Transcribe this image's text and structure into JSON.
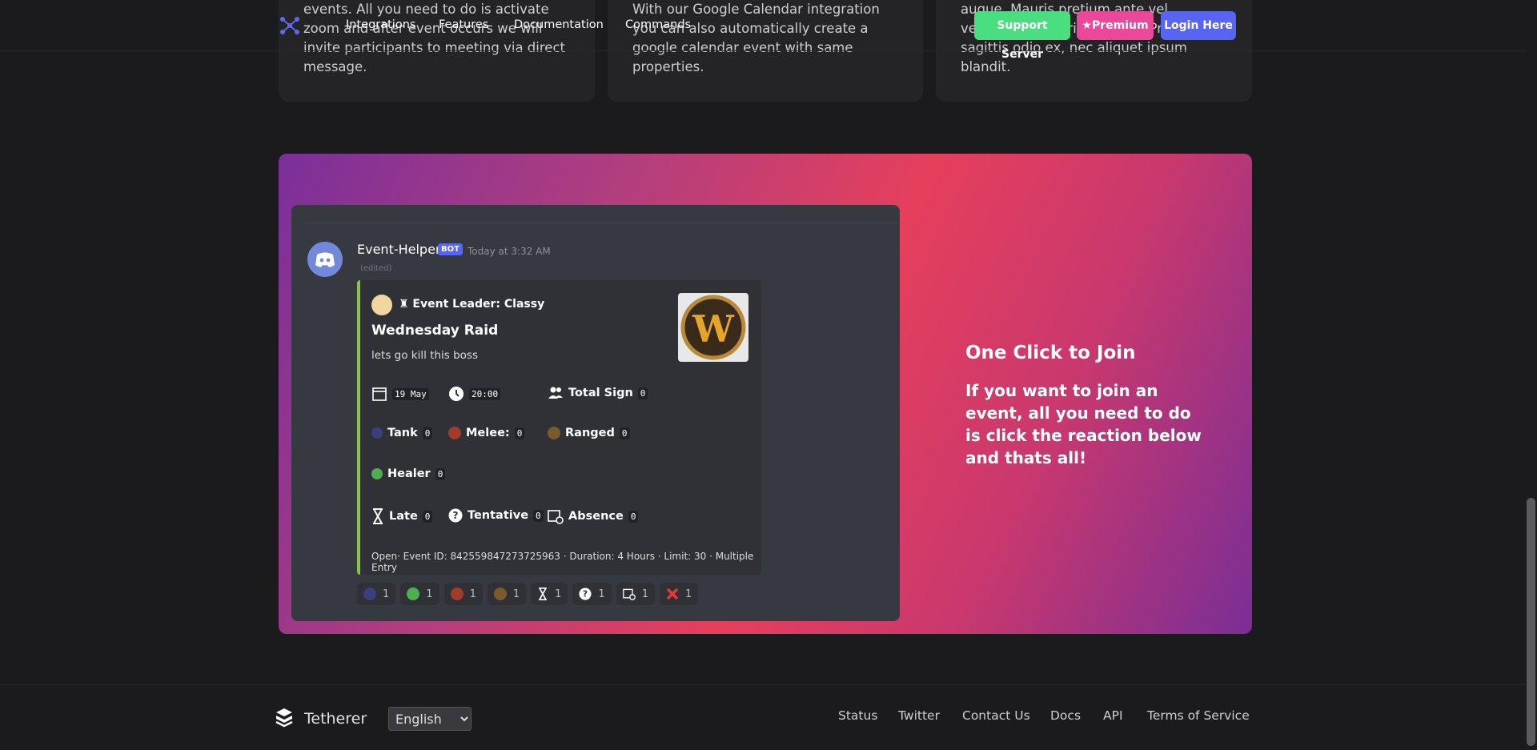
{
  "feature_cards": [
    {
      "text": "events. All you need to do is activate zoom and after event occurs we will invite participants to meeting via direct message."
    },
    {
      "text": "With our Google Calendar integration you can also automatically create a google calendar event with same properties."
    },
    {
      "text": "adipiscing elit. Donec placerat lectus augue. Mauris pretium ante vel vestibulum mauris aliquam. Praesent sagittis odio ex, nec aliquet ipsum blandit."
    }
  ],
  "nav": {
    "links": [
      "Integrations",
      "Features",
      "Documentation",
      "Commands"
    ],
    "support_label": "Support Server",
    "premium_label": "★Premium",
    "login_label": "Login Here",
    "colors": {
      "support": "#4ade80",
      "premium": "#ec4899",
      "login": "#5865f2"
    }
  },
  "message": {
    "username": "Event-Helper",
    "bot_tag": "BOT",
    "timestamp": "Today at 3:32 AM",
    "edited": "(edited)",
    "embed": {
      "leader": "♜ Event Leader: Classy",
      "title": "Wednesday Raid",
      "description": "lets go kill this boss",
      "thumbnail_letter": "W",
      "fields": [
        {
          "label": "19 May",
          "icon": "calendar-icon"
        },
        {
          "label": "20:00",
          "icon": "clock-icon"
        },
        {
          "label": "Total Sign",
          "value": "0",
          "icon": "people-icon"
        },
        {
          "label": "Tank",
          "value": "0",
          "icon": "tank-icon"
        },
        {
          "label": "Melee:",
          "value": "0",
          "icon": "melee-icon"
        },
        {
          "label": "Ranged",
          "value": "0",
          "icon": "ranged-icon"
        },
        {
          "label": "Healer",
          "value": "0",
          "icon": "healer-icon"
        },
        {
          "label": "Late",
          "value": "0",
          "icon": "hourglass-icon"
        },
        {
          "label": "Tentative",
          "value": "0",
          "icon": "question-icon"
        },
        {
          "label": "Absence",
          "value": "0",
          "icon": "absence-icon"
        }
      ],
      "footer": "Open· Event ID: 842559847273725963 · Duration: 4 Hours · Limit: 30 · Multiple Entry",
      "accent": "#8bc34a"
    },
    "reactions": [
      {
        "icon": "tank-icon",
        "count": "1",
        "color": "#3b3f7a"
      },
      {
        "icon": "healer-icon",
        "count": "1",
        "color": "#4caf50"
      },
      {
        "icon": "melee-icon",
        "count": "1",
        "color": "#a33b2a"
      },
      {
        "icon": "ranged-icon",
        "count": "1",
        "color": "#7a5a2a"
      },
      {
        "icon": "hourglass-icon",
        "count": "1",
        "color": "#ffffff"
      },
      {
        "icon": "question-icon",
        "count": "1",
        "color": "#ffffff"
      },
      {
        "icon": "absence-icon",
        "count": "1",
        "color": "#cccccc"
      },
      {
        "icon": "x-icon",
        "count": "1",
        "color": "#e53935"
      }
    ]
  },
  "hero": {
    "title": "One Click to Join",
    "text": "If you want to join an event, all you need to do is click the reaction below and thats all!"
  },
  "footer": {
    "brand": "Tetherer",
    "language": "English",
    "links": [
      "Status",
      "Twitter",
      "Contact Us",
      "Docs",
      "API",
      "Terms of Service"
    ]
  }
}
